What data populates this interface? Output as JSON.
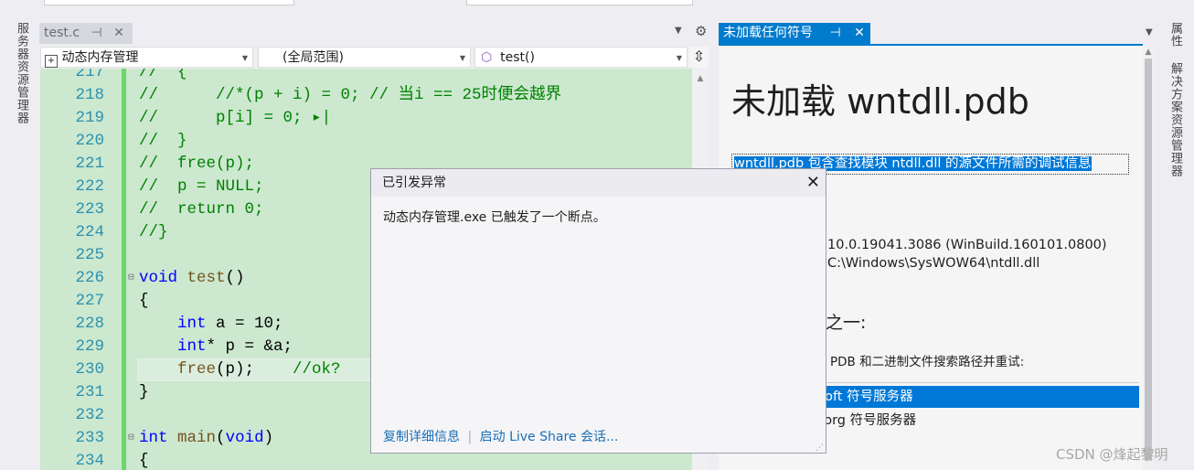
{
  "left_sidebar": {
    "server_explorer": "服务器资源管理器"
  },
  "right_sidebar": {
    "properties": "属性",
    "solution_explorer": "解决方案资源管理器"
  },
  "doc_tab": {
    "label": "test.c",
    "pin": "⊣",
    "close": "✕"
  },
  "nav_bar": {
    "project": "动态内存管理",
    "scope": "(全局范围)",
    "member": "test()"
  },
  "editor": {
    "lines": [
      {
        "n": "217",
        "tokens": [
          {
            "c": "cm",
            "t": "//  {"
          }
        ]
      },
      {
        "n": "218",
        "tokens": [
          {
            "c": "cm",
            "t": "//      //*(p + i) = 0; // 当i == 25时便会越界"
          }
        ]
      },
      {
        "n": "219",
        "tokens": [
          {
            "c": "cm",
            "t": "//      p[i] = 0;"
          },
          {
            "c": "cm",
            "t": " ▸|"
          }
        ]
      },
      {
        "n": "220",
        "tokens": [
          {
            "c": "cm",
            "t": "//  }"
          }
        ]
      },
      {
        "n": "221",
        "tokens": [
          {
            "c": "cm",
            "t": "//  free(p);"
          }
        ]
      },
      {
        "n": "222",
        "tokens": [
          {
            "c": "cm",
            "t": "//  p = NULL;"
          }
        ]
      },
      {
        "n": "223",
        "tokens": [
          {
            "c": "cm",
            "t": "//  return 0;"
          }
        ]
      },
      {
        "n": "224",
        "tokens": [
          {
            "c": "cm",
            "t": "//}"
          }
        ]
      },
      {
        "n": "225",
        "tokens": []
      },
      {
        "n": "226",
        "fold": true,
        "tokens": [
          {
            "c": "kw",
            "t": "void"
          },
          {
            "c": "tx",
            "t": " "
          },
          {
            "c": "fn",
            "t": "test"
          },
          {
            "c": "tx",
            "t": "()"
          }
        ]
      },
      {
        "n": "227",
        "tokens": [
          {
            "c": "tx",
            "t": "{"
          }
        ]
      },
      {
        "n": "228",
        "tokens": [
          {
            "c": "tx",
            "t": "    "
          },
          {
            "c": "kw",
            "t": "int"
          },
          {
            "c": "tx",
            "t": " a = 10;"
          }
        ]
      },
      {
        "n": "229",
        "tokens": [
          {
            "c": "tx",
            "t": "    "
          },
          {
            "c": "kw",
            "t": "int"
          },
          {
            "c": "tx",
            "t": "* p = &a;"
          }
        ]
      },
      {
        "n": "230",
        "current": true,
        "tokens": [
          {
            "c": "tx",
            "t": "    "
          },
          {
            "c": "fn",
            "t": "free"
          },
          {
            "c": "tx",
            "t": "(p);    "
          },
          {
            "c": "cm",
            "t": "//ok?"
          }
        ]
      },
      {
        "n": "231",
        "tokens": [
          {
            "c": "tx",
            "t": "}"
          }
        ]
      },
      {
        "n": "232",
        "tokens": []
      },
      {
        "n": "233",
        "fold": true,
        "tokens": [
          {
            "c": "kw",
            "t": "int"
          },
          {
            "c": "tx",
            "t": " "
          },
          {
            "c": "fn",
            "t": "main"
          },
          {
            "c": "tx",
            "t": "("
          },
          {
            "c": "kw",
            "t": "void"
          },
          {
            "c": "tx",
            "t": ")"
          }
        ]
      },
      {
        "n": "234",
        "tokens": [
          {
            "c": "tx",
            "t": "{"
          }
        ]
      }
    ]
  },
  "exception_dialog": {
    "title": "已引发异常",
    "message": "动态内存管理.exe 已触发了一个断点。",
    "copy_details": "复制详细信息",
    "live_share": "启动 Live Share 会话..."
  },
  "symbol_panel": {
    "tab_label": "未加载任何符号",
    "heading": "未加载 wntdll.pdb",
    "description": "wntdll.pdb 包含查找模块 ntdll.dll 的源文件所需的调试信息",
    "version": "10.0.19041.3086 (WinBuild.160101.0800)",
    "path": "C:\\Windows\\SysWOW64\\ntdll.dll",
    "options_heading": "项之一:",
    "search_paths": "PDB 和二进制文件搜索路径并重试:",
    "servers": [
      {
        "label": "rosoft 符号服务器",
        "selected": true
      },
      {
        "label": "et.org 符号服务器",
        "selected": false
      }
    ]
  },
  "watermark": "CSDN @烽起黎明",
  "colors": {
    "accent": "#007acc",
    "editor_bg": "#cce8cf",
    "comment": "#008000",
    "keyword": "#0000ff"
  }
}
